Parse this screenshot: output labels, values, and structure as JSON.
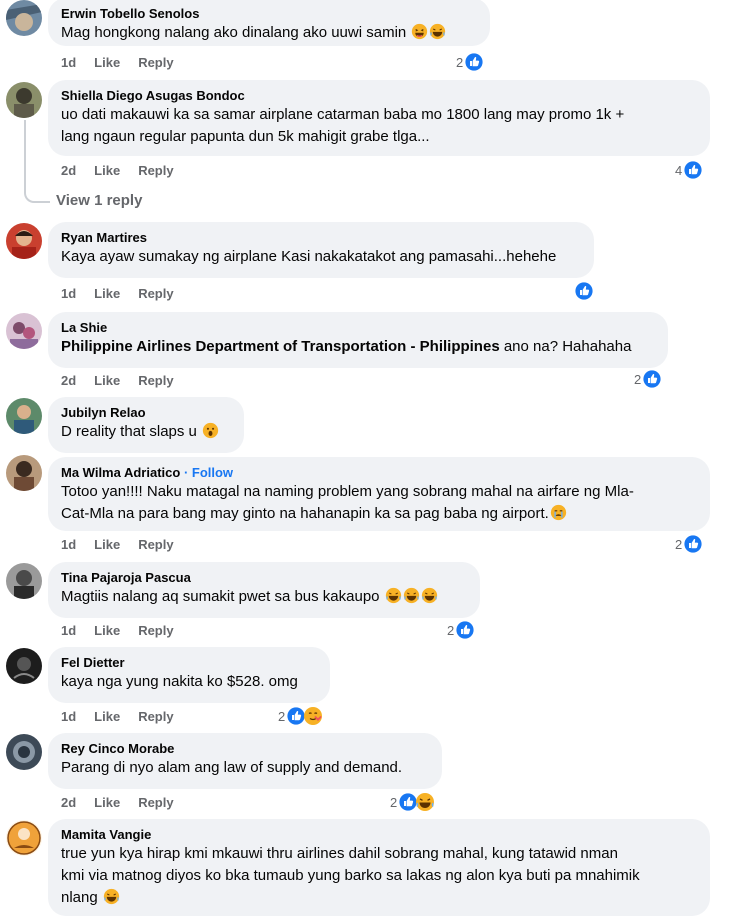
{
  "comments": [
    {
      "author": "Erwin Tobello Senolos",
      "text": "Mag hongkong nalang ako dinalang ako uuwi samin",
      "time": "1d",
      "like": "Like",
      "reply": "Reply",
      "reactions": "2"
    },
    {
      "author": "Shiella Diego Asugas Bondoc",
      "text_line1": "uo dati makauwi ka sa samar airplane catarman baba mo 1800 lang may promo 1k +",
      "text_line2": "lang ngaun regular papunta dun 5k mahigit grabe tlga...",
      "time": "2d",
      "like": "Like",
      "reply": "Reply",
      "reactions": "4",
      "view_replies": "View 1 reply"
    },
    {
      "author": "Ryan Martires",
      "text": "Kaya ayaw sumakay ng airplane Kasi nakakatakot ang pamasahi...hehehe",
      "time": "1d",
      "like": "Like",
      "reply": "Reply",
      "reactions": ""
    },
    {
      "author": "La Shie",
      "tag": "Philippine Airlines Department of Transportation - Philippines",
      "text": " ano na? Hahahaha",
      "time": "2d",
      "like": "Like",
      "reply": "Reply",
      "reactions": "2"
    },
    {
      "author": "Jubilyn Relao",
      "text": "D reality that slaps u"
    },
    {
      "author": "Ma Wilma Adriatico",
      "follow": "· Follow",
      "text_line1": "Totoo yan!!!! Naku matagal na naming problem yang sobrang mahal na airfare ng Mla-",
      "text_line2": "Cat-Mla na para bang may ginto na hahanapin ka sa pag baba ng airport.",
      "time": "1d",
      "like": "Like",
      "reply": "Reply",
      "reactions": "2"
    },
    {
      "author": "Tina Pajaroja Pascua",
      "text": "Magtiis nalang aq sumakit pwet sa bus kakaupo",
      "time": "1d",
      "like": "Like",
      "reply": "Reply",
      "reactions": "2"
    },
    {
      "author": "Fel Dietter",
      "text": "kaya nga yung nakita ko $528. omg",
      "time": "1d",
      "like": "Like",
      "reply": "Reply",
      "reactions": "2"
    },
    {
      "author": "Rey Cinco Morabe",
      "text": "Parang di nyo alam ang law of supply and demand.",
      "time": "2d",
      "like": "Like",
      "reply": "Reply",
      "reactions": "2"
    },
    {
      "author": "Mamita Vangie",
      "text_line1": "true yun kya hirap kmi mkauwi thru airlines dahil sobrang mahal, kung tatawid nman",
      "text_line2": "kmi via matnog diyos ko bka tumaub yung barko sa lakas ng alon kya buti pa mnahimik",
      "text_line3": "nlang"
    }
  ],
  "colors": {
    "like_blue": "#1877f2",
    "bubble": "#f0f2f5",
    "meta_gray": "#65676b"
  }
}
